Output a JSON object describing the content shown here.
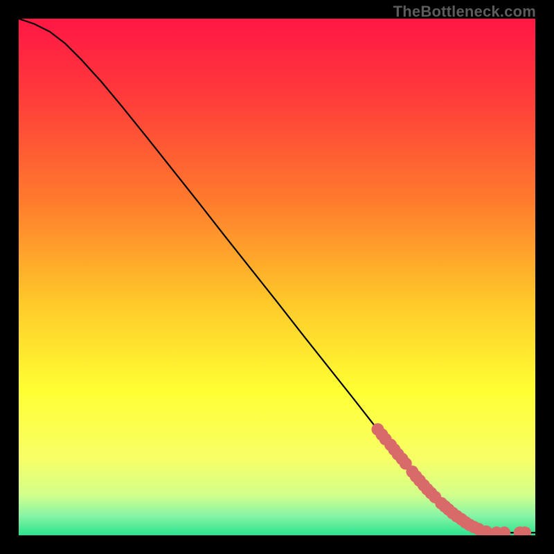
{
  "watermark": "TheBottleneck.com",
  "chart_data": {
    "type": "line",
    "title": "",
    "xlabel": "",
    "ylabel": "",
    "xlim": [
      0,
      100
    ],
    "ylim": [
      0,
      100
    ],
    "grid": false,
    "legend": false,
    "background": {
      "type": "vertical-gradient",
      "stops": [
        {
          "pos": 0.0,
          "color": "#ff1744"
        },
        {
          "pos": 0.15,
          "color": "#ff3b3b"
        },
        {
          "pos": 0.35,
          "color": "#ff7a2d"
        },
        {
          "pos": 0.55,
          "color": "#ffc92a"
        },
        {
          "pos": 0.72,
          "color": "#ffff33"
        },
        {
          "pos": 0.85,
          "color": "#f8ff66"
        },
        {
          "pos": 0.92,
          "color": "#d4ff8a"
        },
        {
          "pos": 0.96,
          "color": "#8cf5a5"
        },
        {
          "pos": 1.0,
          "color": "#2be38f"
        }
      ]
    },
    "series": [
      {
        "name": "curve",
        "type": "line",
        "color": "#000000",
        "x": [
          0,
          3,
          6,
          9,
          12,
          16,
          20,
          25,
          30,
          35,
          40,
          45,
          50,
          55,
          60,
          65,
          70,
          73,
          75,
          77,
          79,
          81,
          83,
          85,
          87,
          89,
          91,
          93,
          95,
          97,
          100
        ],
        "y": [
          100,
          99,
          97.5,
          95.2,
          92.2,
          87.8,
          83,
          76.8,
          70.5,
          64.2,
          57.8,
          51.5,
          45.2,
          38.8,
          32.5,
          26.2,
          19.8,
          16,
          13.5,
          11,
          9,
          7,
          5.2,
          3.8,
          2.5,
          1.5,
          0.8,
          0.5,
          0.5,
          0.5,
          0.5
        ]
      },
      {
        "name": "dots",
        "type": "scatter",
        "color": "#d86a6a",
        "radius": 9,
        "x": [
          69.5,
          70.3,
          71.0,
          72.0,
          72.7,
          73.4,
          74.2,
          74.9,
          76.2,
          76.9,
          77.6,
          78.4,
          79.1,
          79.8,
          80.6,
          81.8,
          82.5,
          83.2,
          84.0,
          84.8,
          85.7,
          86.5,
          87.3,
          88.1,
          89.0,
          90.5,
          92.5,
          94.0,
          97.0,
          98.0
        ],
        "y": [
          20.5,
          19.5,
          18.6,
          17.5,
          16.6,
          15.7,
          14.8,
          13.9,
          12.3,
          11.4,
          10.6,
          9.7,
          8.9,
          8.2,
          7.4,
          6.2,
          5.6,
          5.0,
          4.3,
          3.7,
          3.1,
          2.5,
          2.0,
          1.6,
          1.2,
          0.7,
          0.5,
          0.5,
          0.5,
          0.5
        ]
      }
    ]
  },
  "colors": {
    "frame": "#000000",
    "line": "#000000",
    "dot": "#d86a6a"
  }
}
